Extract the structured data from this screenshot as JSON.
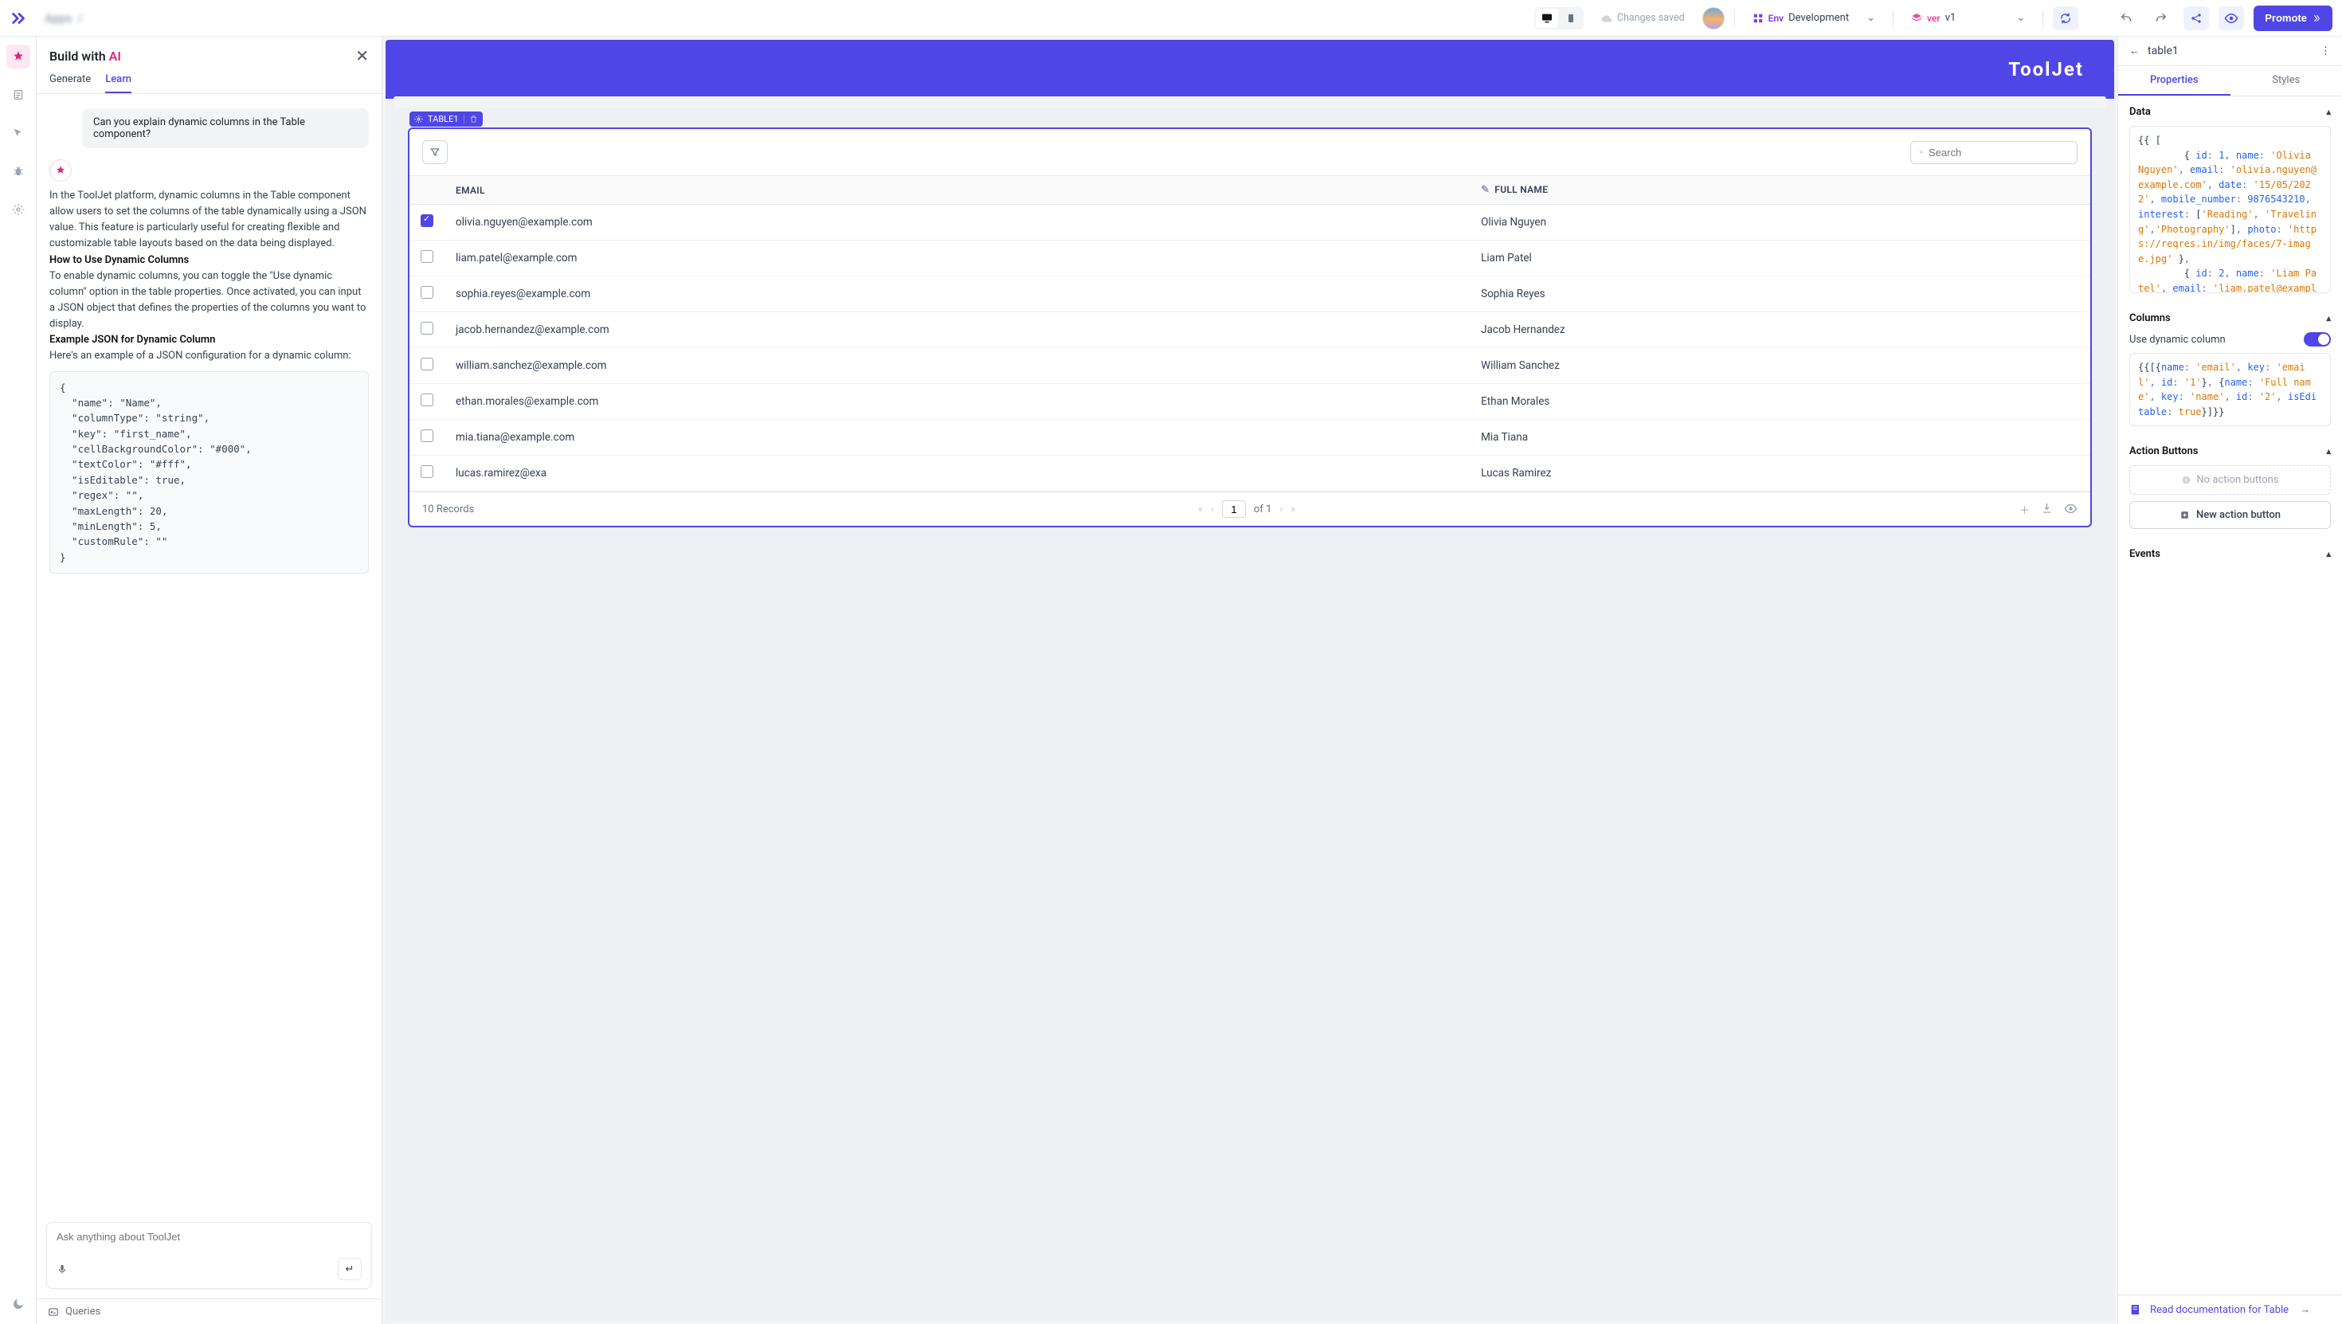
{
  "topbar": {
    "saved": "Changes saved",
    "env_label": "Env",
    "env_value": "Development",
    "ver_label": "ver",
    "ver_value": "v1",
    "promote": "Promote"
  },
  "ai": {
    "title_prefix": "Build with ",
    "title_ai": "AI",
    "tabs": {
      "generate": "Generate",
      "learn": "Learn"
    },
    "user_question": "Can you explain dynamic columns in the Table component?",
    "para1": "In the ToolJet platform, dynamic columns in the Table component allow users to set the columns of the table dynamically using a JSON value. This feature is particularly useful for creating flexible and customizable table layouts based on the data being displayed.",
    "h1": "How to Use Dynamic Columns",
    "para2": "To enable dynamic columns, you can toggle the \"Use dynamic column\" option in the table properties. Once activated, you can input a JSON object that defines the properties of the columns you want to display.",
    "h2": "Example JSON for Dynamic Column",
    "para3": "Here's an example of a JSON configuration for a dynamic column:",
    "code": "{\n  \"name\": \"Name\",\n  \"columnType\": \"string\",\n  \"key\": \"first_name\",\n  \"cellBackgroundColor\": \"#000\",\n  \"textColor\": \"#fff\",\n  \"isEditable\": true,\n  \"regex\": \"\",\n  \"maxLength\": 20,\n  \"minLength\": 5,\n  \"customRule\": \"\"\n}",
    "input_placeholder": "Ask anything about ToolJet",
    "queries": "Queries"
  },
  "canvas": {
    "brand": "ToolJet",
    "widget_name": "TABLE1",
    "search_placeholder": "Search",
    "columns": {
      "email": "EMAIL",
      "fullname": "FULL NAME"
    },
    "footer": {
      "records": "10 Records",
      "page": "1",
      "of": "of 1"
    },
    "rows": [
      {
        "checked": true,
        "email": "olivia.nguyen@example.com",
        "name": "Olivia Nguyen"
      },
      {
        "checked": false,
        "email": "liam.patel@example.com",
        "name": "Liam Patel"
      },
      {
        "checked": false,
        "email": "sophia.reyes@example.com",
        "name": "Sophia Reyes"
      },
      {
        "checked": false,
        "email": "jacob.hernandez@example.com",
        "name": "Jacob Hernandez"
      },
      {
        "checked": false,
        "email": "william.sanchez@example.com",
        "name": "William Sanchez"
      },
      {
        "checked": false,
        "email": "ethan.morales@example.com",
        "name": "Ethan Morales"
      },
      {
        "checked": false,
        "email": "mia.tiana@example.com",
        "name": "Mia Tiana"
      },
      {
        "checked": false,
        "email": "lucas.ramirez@exa",
        "name": "Lucas Ramirez"
      }
    ]
  },
  "props": {
    "name": "table1",
    "tabs": {
      "properties": "Properties",
      "styles": "Styles"
    },
    "sections": {
      "data": "Data",
      "columns": "Columns",
      "action": "Action Buttons",
      "events": "Events"
    },
    "dynamic_label": "Use dynamic column",
    "no_action": "No action buttons",
    "new_action": "New action button",
    "doc_link": "Read documentation for Table"
  }
}
